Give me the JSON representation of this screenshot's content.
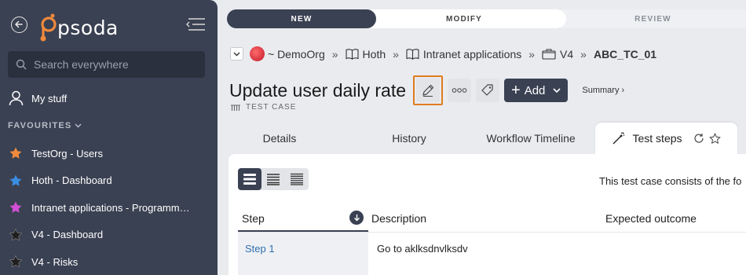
{
  "app": {
    "logo_text": "psoda"
  },
  "sidebar": {
    "search_placeholder": "Search everywhere",
    "my_stuff_label": "My stuff",
    "favourites_label": "FAVOURITES",
    "favourites": [
      {
        "label": "TestOrg - Users",
        "star_color": "#f08a3c"
      },
      {
        "label": "Hoth - Dashboard",
        "star_color": "#3b8de0"
      },
      {
        "label": "Intranet applications - Programme…",
        "star_color": "#d24fd6"
      },
      {
        "label": "V4 - Dashboard",
        "star_color": "#222222"
      },
      {
        "label": "V4 - Risks",
        "star_color": "#222222"
      }
    ]
  },
  "workflow": {
    "stages": [
      "NEW",
      "MODIFY",
      "REVIEW"
    ],
    "current": "NEW"
  },
  "breadcrumb": {
    "org": "~ DemoOrg",
    "portfolio": "Hoth",
    "programme": "Intranet applications",
    "project": "V4",
    "current": "ABC_TC_01",
    "separator": "»"
  },
  "page": {
    "title": "Update user daily rate",
    "type_label": "TEST CASE",
    "add_label": "Add",
    "summary_label": "Summary ›"
  },
  "tabs": [
    {
      "label": "Details"
    },
    {
      "label": "History"
    },
    {
      "label": "Workflow Timeline"
    },
    {
      "label": "Test steps",
      "active": true
    }
  ],
  "panel": {
    "consists_text": "This test case consists of the fo",
    "columns": [
      "Step",
      "Description",
      "Expected outcome"
    ],
    "rows": [
      {
        "step": "Step 1",
        "description": "Go to aklksdnvlksdv"
      }
    ]
  },
  "colors": {
    "sidebar_bg": "#3a4152",
    "accent_dark": "#3a4152",
    "highlight_orange": "#e07b1f",
    "link_blue": "#2f6fb0"
  }
}
